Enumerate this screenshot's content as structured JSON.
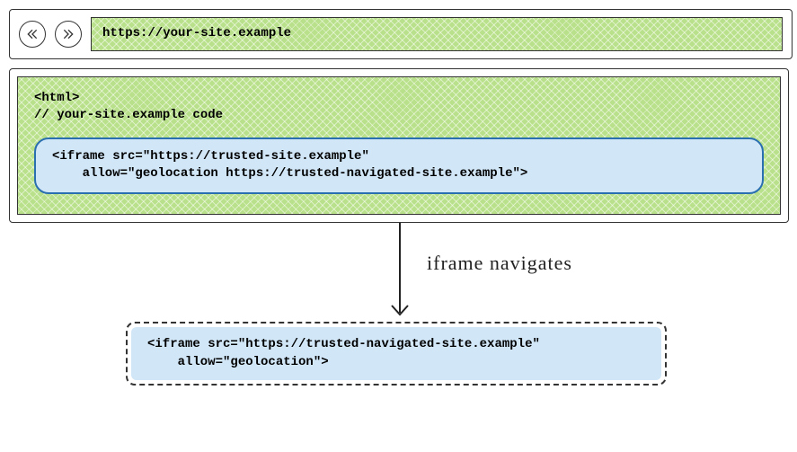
{
  "toolbar": {
    "url": "https://your-site.example"
  },
  "page": {
    "html_open": "<html>",
    "comment": "// your-site.example code",
    "iframe1_line1": "<iframe src=\"https://trusted-site.example\"",
    "iframe1_line2": "    allow=\"geolocation https://trusted-navigated-site.example\">"
  },
  "navigation": {
    "label": "iframe navigates"
  },
  "result": {
    "iframe2_line1": "<iframe src=\"https://trusted-navigated-site.example\"",
    "iframe2_line2": "    allow=\"geolocation\">"
  }
}
